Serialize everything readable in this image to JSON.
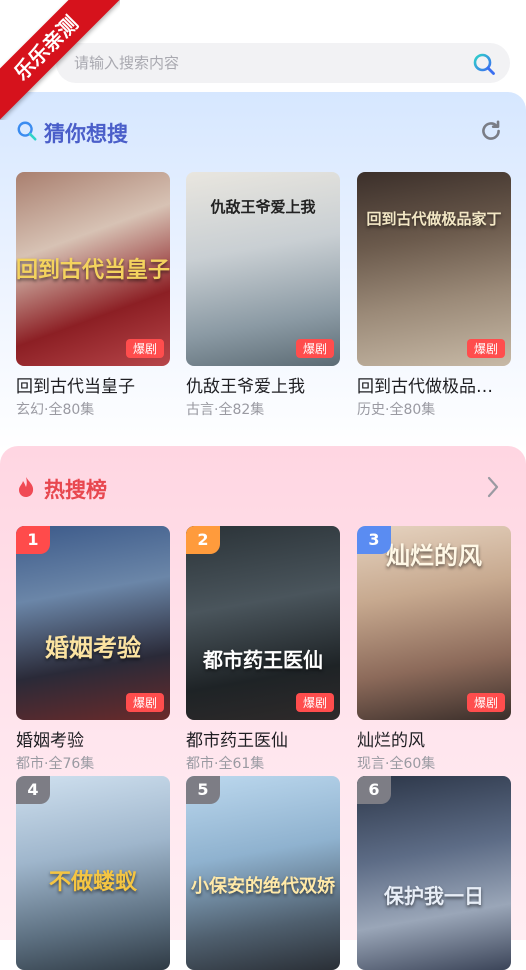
{
  "ribbon": {
    "text": "乐乐亲测"
  },
  "search": {
    "placeholder": "请输入搜索内容"
  },
  "guess": {
    "title": "猜你想搜",
    "items": [
      {
        "title": "回到古代当皇子",
        "meta": "玄幻·全80集",
        "badge": "爆剧",
        "poster_text": "回到古代当皇子"
      },
      {
        "title": "仇敌王爷爱上我",
        "meta": "古言·全82集",
        "badge": "爆剧",
        "poster_text": "仇敌王爷爱上我"
      },
      {
        "title": "回到古代做极品家丁",
        "meta": "历史·全80集",
        "badge": "爆剧",
        "poster_text": "回到古代做极品家丁"
      }
    ]
  },
  "hot": {
    "title": "热搜榜",
    "items": [
      {
        "rank": "1",
        "title": "婚姻考验",
        "meta": "都市·全76集",
        "badge": "爆剧",
        "poster_text": "婚姻考验"
      },
      {
        "rank": "2",
        "title": "都市药王医仙",
        "meta": "都市·全61集",
        "badge": "爆剧",
        "poster_text": "都市药王医仙"
      },
      {
        "rank": "3",
        "title": "灿烂的风",
        "meta": "现言·全60集",
        "badge": "爆剧",
        "poster_text": "灿烂的风"
      },
      {
        "rank": "4",
        "poster_text": "不做蝼蚁"
      },
      {
        "rank": "5",
        "poster_text": "小保安的绝代双娇"
      },
      {
        "rank": "6",
        "poster_text": "保护我一日"
      }
    ]
  },
  "colors": {
    "guess_title": "#4a5ec9",
    "hot_title": "#e8474f",
    "badge": "#ff4d4d"
  }
}
